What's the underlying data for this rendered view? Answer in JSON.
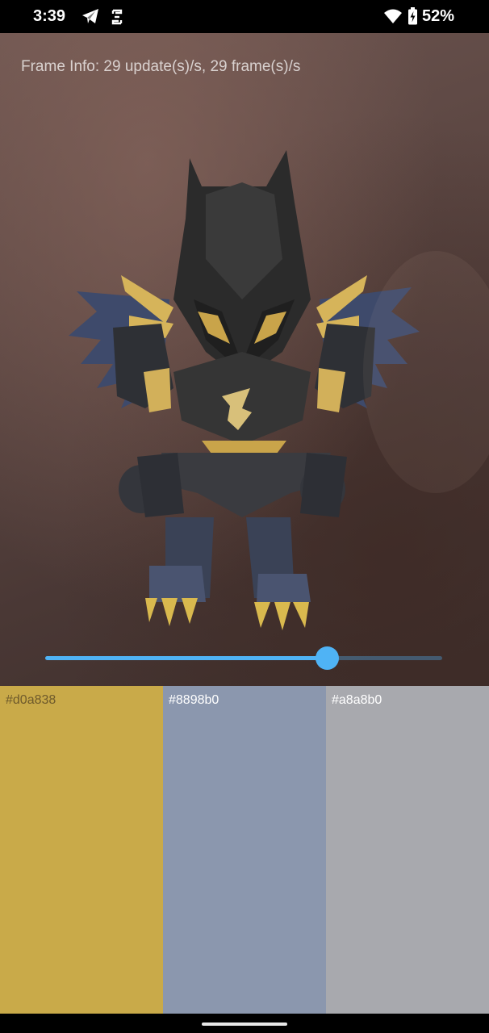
{
  "status_bar": {
    "time": "3:39",
    "battery": "52%",
    "icons": [
      "telegram-icon",
      "sync-icon",
      "wifi-icon",
      "battery-charging-icon"
    ]
  },
  "camera": {
    "frame_info": "Frame Info: 29 update(s)/s, 29 frame(s)/s"
  },
  "slider": {
    "value": 0.71
  },
  "palette": [
    {
      "label": "#d0a838",
      "color": "#c9aa49",
      "text_color": "#6e5a2c"
    },
    {
      "label": "#8898b0",
      "color": "#8b97ae",
      "text_color": "#ffffff"
    },
    {
      "label": "#a8a8b0",
      "color": "#a8a9ae",
      "text_color": "#ffffff"
    }
  ]
}
